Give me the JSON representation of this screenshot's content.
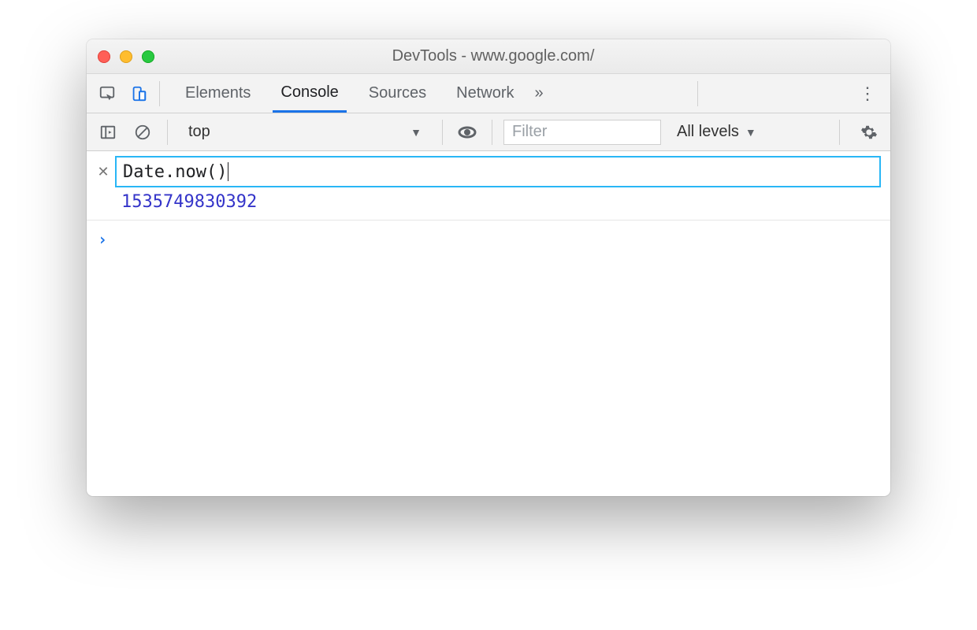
{
  "window": {
    "title": "DevTools - www.google.com/"
  },
  "tabs": [
    "Elements",
    "Console",
    "Sources",
    "Network"
  ],
  "toolbar": {
    "context": "top",
    "filter_placeholder": "Filter",
    "levels": "All levels"
  },
  "console": {
    "expression": "Date.now()",
    "result": "1535749830392"
  }
}
